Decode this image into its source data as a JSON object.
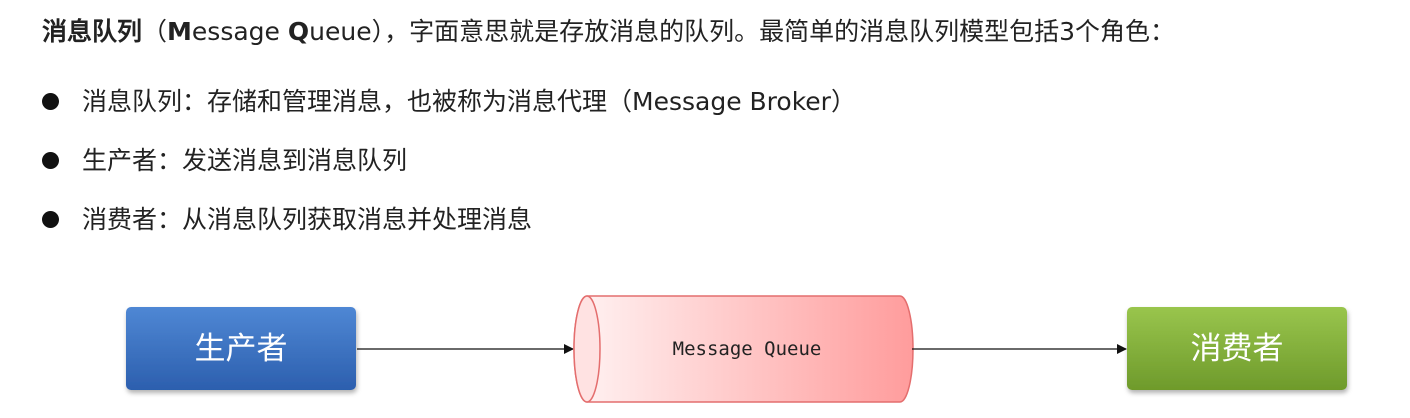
{
  "intro": {
    "term_zh": "消息队列",
    "paren_open": "（",
    "term_en_m": "M",
    "term_en_essage": "essage ",
    "term_en_q": "Q",
    "term_en_ueue": "ueue",
    "rest": "），字面意思就是存放消息的队列。最简单的消息队列模型包括3个角色："
  },
  "bullets": [
    {
      "text": "消息队列：存储和管理消息，也被称为消息代理（Message Broker）"
    },
    {
      "text": "生产者：发送消息到消息队列"
    },
    {
      "text": "消费者：从消息队列获取消息并处理消息"
    }
  ],
  "diagram": {
    "producer_label": "生产者",
    "queue_label": "Message Queue",
    "consumer_label": "消费者",
    "colors": {
      "producer_top": "#4f87d4",
      "producer_bottom": "#2c5fae",
      "queue_left": "#fff3f3",
      "queue_right": "#ff9c9c",
      "queue_border": "#e46e6e",
      "consumer_top": "#99c54d",
      "consumer_bottom": "#6e9a2b",
      "arrow": "#111111"
    }
  }
}
